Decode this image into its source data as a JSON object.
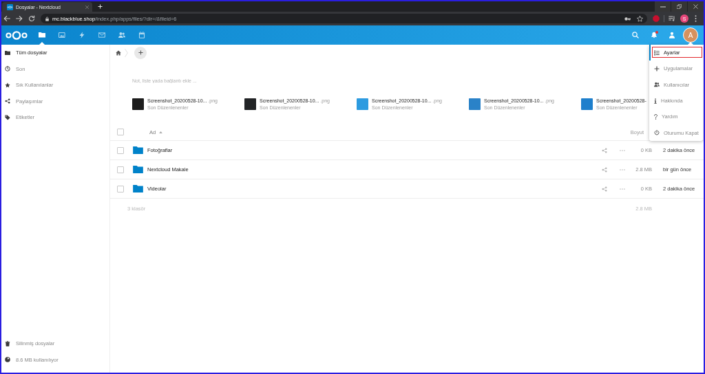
{
  "browser": {
    "tabs": [
      {
        "title": "Dosyalar - Nextcloud",
        "selected": true
      }
    ],
    "address": {
      "host": "mc.blackblue.shop",
      "path": "/index.php/apps/files/?dir=/&fileid=6"
    },
    "profile_initial": "S"
  },
  "header": {
    "apps": [
      {
        "kind": "files",
        "selected": true
      },
      {
        "kind": "photos",
        "selected": false
      },
      {
        "kind": "activity",
        "selected": false
      },
      {
        "kind": "mail",
        "selected": false
      },
      {
        "kind": "contacts",
        "selected": false
      },
      {
        "kind": "calendar",
        "selected": false
      }
    ],
    "notifications": {
      "unread": true
    },
    "avatar_initial": "A"
  },
  "sidebar": {
    "items": [
      {
        "kind": "files",
        "label": "Tüm dosyalar",
        "selected": true
      },
      {
        "kind": "recent",
        "label": "Son",
        "selected": false
      },
      {
        "kind": "favorites",
        "label": "Sık Kullanılanlar",
        "selected": false
      },
      {
        "kind": "shares",
        "label": "Paylaşımlar",
        "selected": false
      },
      {
        "kind": "tags",
        "label": "Etiketler",
        "selected": false
      }
    ],
    "footer": [
      {
        "kind": "trash",
        "label": "Silinmiş dosyalar"
      },
      {
        "kind": "quota",
        "label": "8.6 MB kullanılıyor"
      }
    ]
  },
  "workspace": {
    "placeholder": "Not, liste yada bağlantı ekle ..."
  },
  "recent": [
    {
      "name": "Screenshot_20200528-10...",
      "ext": ".png",
      "subtitle": "Son Düzenlenenler",
      "color": "#1c1c1c"
    },
    {
      "name": "Screenshot_20200528-10...",
      "ext": ".png",
      "subtitle": "Son Düzenlenenler",
      "color": "#222426"
    },
    {
      "name": "Screenshot_20200528-10...",
      "ext": ".png",
      "subtitle": "Son Düzenlenenler",
      "color": "#2d9be0"
    },
    {
      "name": "Screenshot_20200528-10...",
      "ext": ".png",
      "subtitle": "Son Düzenlenenler",
      "color": "#2a82c8"
    },
    {
      "name": "Screenshot_20200528-",
      "subtitle": "Son Düzenlenenler",
      "color": "#1e7fcc"
    }
  ],
  "table": {
    "select_all": {
      "checked": false
    },
    "columns": [
      {
        "label": "Ad",
        "sorted": true
      },
      {
        "label": "Boyut",
        "sorted": false
      }
    ],
    "rows": [
      {
        "name": "Fotoğraflar",
        "size": "0 KB",
        "modified": "2 dakika önce",
        "checked": false
      },
      {
        "name": "Nextcloud Makale",
        "size": "2.8 MB",
        "modified": "bir gün önce",
        "checked": false
      },
      {
        "name": "Videolar",
        "size": "0 KB",
        "modified": "2 dakika önce",
        "checked": false
      }
    ],
    "summary": {
      "count": "3 klasör",
      "size": "2.8 MB"
    }
  },
  "user_menu": {
    "items": [
      {
        "kind": "settings",
        "label": "Ayarlar",
        "selected": true,
        "outlined": true
      },
      {
        "kind": "apps",
        "label": "Uygulamalar",
        "selected": false,
        "outlined": false
      },
      {
        "kind": "users",
        "label": "Kullanıcılar",
        "selected": false,
        "outlined": false
      },
      {
        "kind": "about",
        "label": "Hakkında",
        "selected": false,
        "outlined": false
      },
      {
        "kind": "help",
        "label": "Yardım",
        "selected": false,
        "outlined": false
      },
      {
        "kind": "logout",
        "label": "Oturumu Kapat",
        "selected": false,
        "outlined": false
      }
    ]
  }
}
